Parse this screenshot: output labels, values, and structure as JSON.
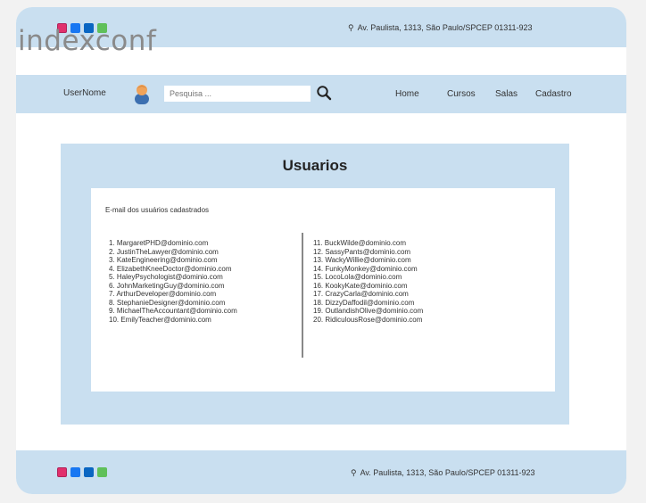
{
  "header": {
    "address": "Av. Paulista, 1313, São Paulo/SPCEP 01311-923",
    "logo_text": "indexconf"
  },
  "navbar": {
    "username": "UserNome",
    "search_placeholder": "Pesquisa ...",
    "links": [
      "Home",
      "Cursos",
      "Salas",
      "Cadastro"
    ]
  },
  "main": {
    "title": "Usuarios",
    "subtitle": "E-mail dos usuários cadastrados",
    "emails_left": [
      "1. MargaretPHD@dominio.com",
      "2. JustinTheLawyer@dominio.com",
      "3. KateEngineering@dominio.com",
      "4. ElizabethKneeDoctor@dominio.com",
      "5. HaleyPsychologist@dominio.com",
      "6. JohnMarketingGuy@dominio.com",
      "7. ArthurDeveloper@dominio.com",
      "8. StephanieDesigner@dominio.com",
      "9. MichaelTheAccountant@dominio.com",
      "10. EmilyTeacher@dominio.com"
    ],
    "emails_right": [
      "11. BuckWilde@dominio.com",
      "12. SassyPants@dominio.com",
      "13. WackyWillie@dominio.com",
      "14. FunkyMonkey@dominio.com",
      "15. LocoLola@dominio.com",
      "16. KookyKate@dominio.com",
      "17. CrazyCarla@dominio.com",
      "18. DizzyDaffodil@dominio.com",
      "19. OutlandishOlive@dominio.com",
      "20. RidiculousRose@dominio.com"
    ]
  },
  "footer": {
    "address": "Av. Paulista, 1313, São Paulo/SPCEP 01311-923"
  },
  "icons": {
    "social": [
      "instagram-icon",
      "facebook-icon",
      "linkedin-icon",
      "whatsapp-icon"
    ],
    "location": "map-pin-icon",
    "search": "search-icon",
    "avatar": "user-avatar-icon"
  },
  "colors": {
    "panel": "#c9dff0",
    "card": "#ffffff",
    "page_bg": "#f2f2f2"
  }
}
